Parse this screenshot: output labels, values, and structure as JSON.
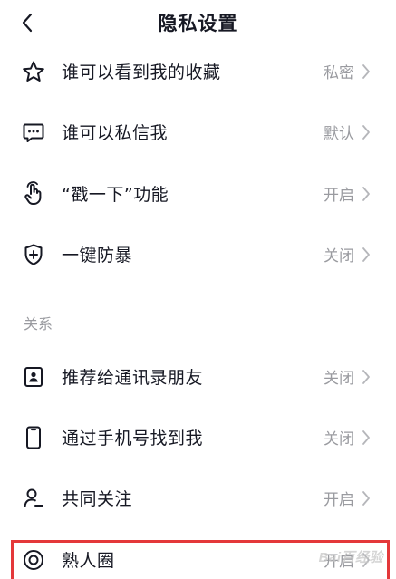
{
  "header": {
    "title": "隐私设置"
  },
  "items_top": [
    {
      "label": "谁可以看到我的收藏",
      "value": "私密",
      "icon": "star-icon"
    },
    {
      "label": "谁可以私信我",
      "value": "默认",
      "icon": "message-icon"
    },
    {
      "label": "“戳一下”功能",
      "value": "开启",
      "icon": "poke-hand-icon"
    },
    {
      "label": "一键防暴",
      "value": "关闭",
      "icon": "shield-plus-icon"
    }
  ],
  "section": {
    "label": "关系"
  },
  "items_relation": [
    {
      "label": "推荐给通讯录朋友",
      "value": "关闭",
      "icon": "contact-card-icon"
    },
    {
      "label": "通过手机号找到我",
      "value": "关闭",
      "icon": "phone-icon"
    },
    {
      "label": "共同关注",
      "value": "开启",
      "icon": "mutual-follow-icon"
    },
    {
      "label": "熟人圈",
      "value": "开启",
      "icon": "circle-target-icon"
    }
  ],
  "watermark": {
    "text": "Bai百经验"
  },
  "colors": {
    "text_primary": "#161823",
    "text_secondary": "#9a9ba0",
    "highlight": "#e4383a"
  }
}
